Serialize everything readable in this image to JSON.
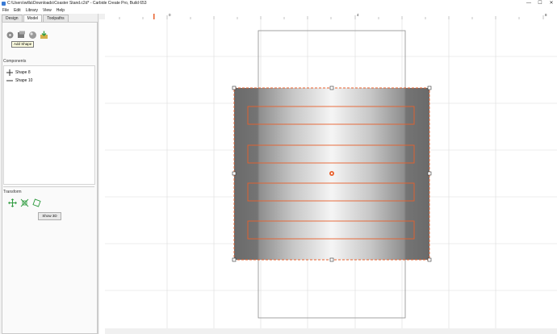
{
  "window": {
    "title": "C:\\Users\\willa\\Downloads\\Coaster Stand.c2d* - Carbide Create Pro, Build 653",
    "controls": {
      "minimize": "—",
      "maximize": "☐",
      "close": "✕"
    }
  },
  "menu": [
    "File",
    "Edit",
    "Library",
    "View",
    "Help"
  ],
  "tabs": [
    "Design",
    "Model",
    "Toolpaths"
  ],
  "active_tab": "Model",
  "tools": [
    {
      "icon": "gear-shape-icon"
    },
    {
      "icon": "add-shape-icon"
    },
    {
      "icon": "sphere-icon"
    },
    {
      "icon": "import-icon"
    }
  ],
  "tooltip": "Add Shape",
  "components": {
    "label": "Components",
    "items": [
      {
        "icon": "plus-icon",
        "label": "Shape 8"
      },
      {
        "icon": "line-icon",
        "label": "Shape 10"
      }
    ]
  },
  "transform": {
    "label": "Transform",
    "tools": [
      {
        "icon": "move-icon"
      },
      {
        "icon": "scale-icon"
      },
      {
        "icon": "rotate-icon"
      }
    ]
  },
  "show3d_label": "Show 3D",
  "ruler": {
    "top_ticks": [
      "0",
      "4",
      "8"
    ],
    "left_marker": "◂"
  },
  "colors": {
    "selection": "#e8602c",
    "dark_panel": "#6f6f6f",
    "accent_tab": "#fafafa"
  }
}
